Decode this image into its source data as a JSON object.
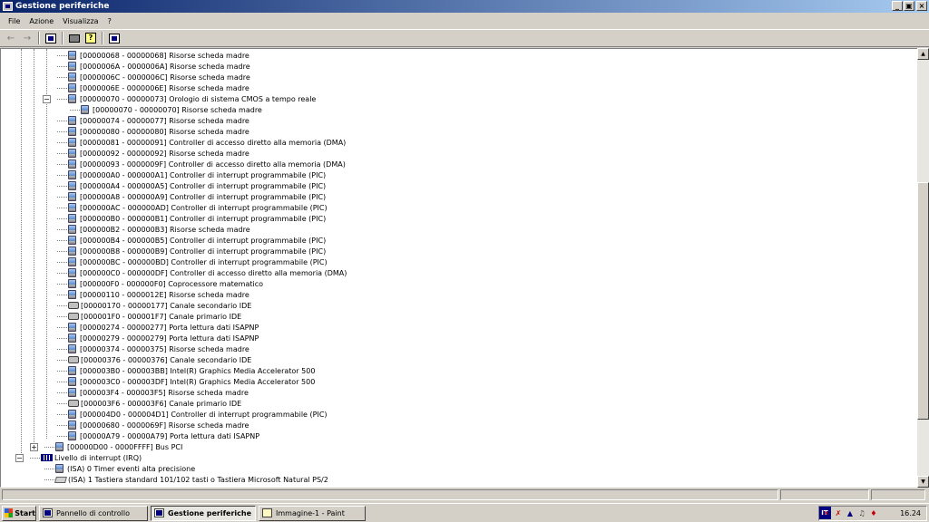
{
  "window": {
    "title": "Gestione periferiche",
    "minimize": "_",
    "maximize": "▣",
    "close": "×"
  },
  "menu": [
    "File",
    "Azione",
    "Visualizza",
    "?"
  ],
  "toolbar": {
    "back": "←",
    "forward": "→"
  },
  "tree": [
    {
      "label": "[00000068 - 00000068]  Risorse scheda madre",
      "icon": "chip-icon",
      "level": 3
    },
    {
      "label": "[0000006A - 0000006A]  Risorse scheda madre",
      "icon": "chip-icon",
      "level": 3
    },
    {
      "label": "[0000006C - 0000006C]  Risorse scheda madre",
      "icon": "chip-icon",
      "level": 3
    },
    {
      "label": "[0000006E - 0000006E]  Risorse scheda madre",
      "icon": "chip-icon",
      "level": 3
    },
    {
      "label": "[00000070 - 00000073]  Orologio di sistema CMOS a tempo reale",
      "icon": "chip-icon",
      "level": 3,
      "expander": "−"
    },
    {
      "label": "[00000070 - 00000070]  Risorse scheda madre",
      "icon": "chip-icon",
      "level": 4
    },
    {
      "label": "[00000074 - 00000077]  Risorse scheda madre",
      "icon": "chip-icon",
      "level": 3
    },
    {
      "label": "[00000080 - 00000080]  Risorse scheda madre",
      "icon": "chip-icon",
      "level": 3
    },
    {
      "label": "[00000081 - 00000091]  Controller di accesso diretto alla memoria (DMA)",
      "icon": "chip-icon",
      "level": 3
    },
    {
      "label": "[00000092 - 00000092]  Risorse scheda madre",
      "icon": "chip-icon",
      "level": 3
    },
    {
      "label": "[00000093 - 0000009F]  Controller di accesso diretto alla memoria (DMA)",
      "icon": "chip-icon",
      "level": 3
    },
    {
      "label": "[000000A0 - 000000A1]  Controller di interrupt programmabile (PIC)",
      "icon": "chip-icon",
      "level": 3
    },
    {
      "label": "[000000A4 - 000000A5]  Controller di interrupt programmabile (PIC)",
      "icon": "chip-icon",
      "level": 3
    },
    {
      "label": "[000000A8 - 000000A9]  Controller di interrupt programmabile (PIC)",
      "icon": "chip-icon",
      "level": 3
    },
    {
      "label": "[000000AC - 000000AD]  Controller di interrupt programmabile (PIC)",
      "icon": "chip-icon",
      "level": 3
    },
    {
      "label": "[000000B0 - 000000B1]  Controller di interrupt programmabile (PIC)",
      "icon": "chip-icon",
      "level": 3
    },
    {
      "label": "[000000B2 - 000000B3]  Risorse scheda madre",
      "icon": "chip-icon",
      "level": 3
    },
    {
      "label": "[000000B4 - 000000B5]  Controller di interrupt programmabile (PIC)",
      "icon": "chip-icon",
      "level": 3
    },
    {
      "label": "[000000B8 - 000000B9]  Controller di interrupt programmabile (PIC)",
      "icon": "chip-icon",
      "level": 3
    },
    {
      "label": "[000000BC - 000000BD]  Controller di interrupt programmabile (PIC)",
      "icon": "chip-icon",
      "level": 3
    },
    {
      "label": "[000000C0 - 000000DF]  Controller di accesso diretto alla memoria (DMA)",
      "icon": "chip-icon",
      "level": 3
    },
    {
      "label": "[000000F0 - 000000F0]  Coprocessore matematico",
      "icon": "chip-icon",
      "level": 3
    },
    {
      "label": "[00000110 - 0000012E]  Risorse scheda madre",
      "icon": "chip-icon",
      "level": 3
    },
    {
      "label": "[00000170 - 00000177]  Canale secondario IDE",
      "icon": "drive-icon",
      "level": 3
    },
    {
      "label": "[000001F0 - 000001F7]  Canale primario IDE",
      "icon": "drive-icon",
      "level": 3
    },
    {
      "label": "[00000274 - 00000277]  Porta lettura dati ISAPNP",
      "icon": "chip-icon",
      "level": 3
    },
    {
      "label": "[00000279 - 00000279]  Porta lettura dati ISAPNP",
      "icon": "chip-icon",
      "level": 3
    },
    {
      "label": "[00000374 - 00000375]  Risorse scheda madre",
      "icon": "chip-icon",
      "level": 3
    },
    {
      "label": "[00000376 - 00000376]  Canale secondario IDE",
      "icon": "drive-icon",
      "level": 3
    },
    {
      "label": "[000003B0 - 000003BB]  Intel(R) Graphics Media Accelerator 500",
      "icon": "chip-icon",
      "level": 3
    },
    {
      "label": "[000003C0 - 000003DF]  Intel(R) Graphics Media Accelerator 500",
      "icon": "chip-icon",
      "level": 3
    },
    {
      "label": "[000003F4 - 000003F5]  Risorse scheda madre",
      "icon": "chip-icon",
      "level": 3
    },
    {
      "label": "[000003F6 - 000003F6]  Canale primario IDE",
      "icon": "drive-icon",
      "level": 3
    },
    {
      "label": "[000004D0 - 000004D1]  Controller di interrupt programmabile (PIC)",
      "icon": "chip-icon",
      "level": 3
    },
    {
      "label": "[00000680 - 0000069F]  Risorse scheda madre",
      "icon": "chip-icon",
      "level": 3
    },
    {
      "label": "[00000A79 - 00000A79]  Porta lettura dati ISAPNP",
      "icon": "chip-icon",
      "level": 3
    },
    {
      "label": "[00000D00 - 0000FFFF]  Bus PCI",
      "icon": "chip-icon",
      "level": 2,
      "expander": "+"
    },
    {
      "label": "Livello di interrupt (IRQ)",
      "icon": "irq-icon",
      "level": 1,
      "expander": "−"
    },
    {
      "label": "(ISA)  0    Timer eventi alta precisione",
      "icon": "chip-icon",
      "level": 2
    },
    {
      "label": "(ISA)  1    Tastiera standard 101/102 tasti o Tastiera Microsoft Natural PS/2",
      "icon": "keyboard-icon",
      "level": 2
    }
  ],
  "taskbar": {
    "start": "Start",
    "tasks": [
      {
        "label": "Pannello di controllo",
        "active": false
      },
      {
        "label": "Gestione periferiche",
        "active": true
      },
      {
        "label": "Immagine-1 - Paint",
        "active": false
      }
    ],
    "lang": "IT",
    "clock": "16.24"
  }
}
